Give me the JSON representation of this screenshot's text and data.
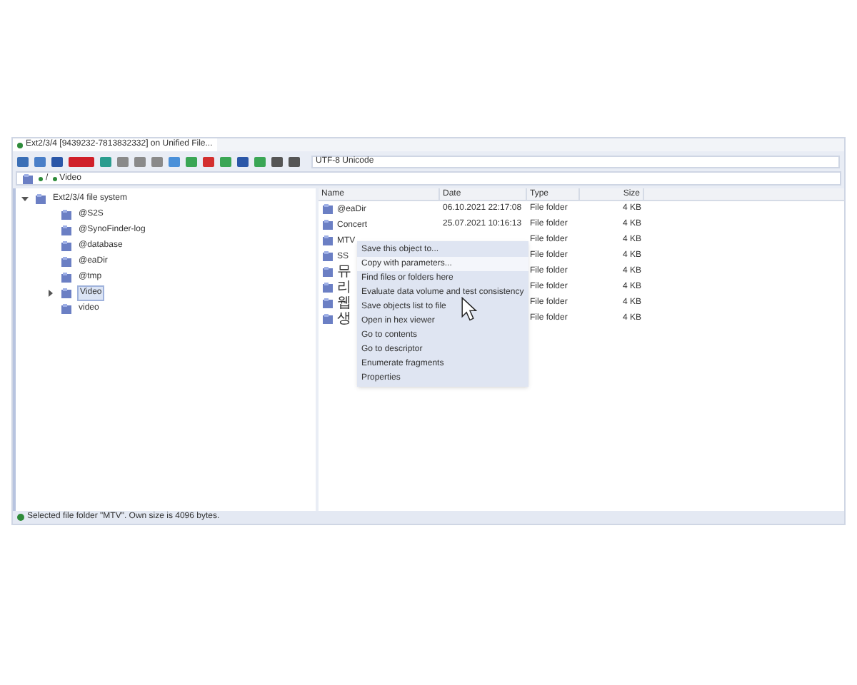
{
  "window": {
    "tab_title": "Ext2/3/4 [9439232-7813832332] on Unified File..."
  },
  "toolbar": {
    "encoding": "UTF-8 Unicode"
  },
  "path": [
    "/",
    "Video"
  ],
  "tree": {
    "label": "Ext2/3/4 file system",
    "expanded": true,
    "selected": false,
    "children": [
      {
        "label": "@S2S",
        "selected": false
      },
      {
        "label": "@SynoFinder-log",
        "selected": false
      },
      {
        "label": "@database",
        "selected": false
      },
      {
        "label": "@eaDir",
        "selected": false
      },
      {
        "label": "@tmp",
        "selected": false
      },
      {
        "label": "Video",
        "selected": true,
        "has_children": true
      },
      {
        "label": "video",
        "selected": false
      }
    ]
  },
  "table": {
    "columns": [
      "Name",
      "Date",
      "Type",
      "Size"
    ],
    "rows": [
      {
        "name": "@eaDir",
        "date": "06.10.2021 22:17:08",
        "type": "File folder",
        "size": "4 KB"
      },
      {
        "name": "Concert",
        "date": "25.07.2021 10:16:13",
        "type": "File folder",
        "size": "4 KB"
      },
      {
        "name": "MTV",
        "date": "",
        "type": "File folder",
        "size": "4 KB"
      },
      {
        "name": "SS",
        "date": "",
        "type": "File folder",
        "size": "4 KB"
      },
      {
        "name": "뮤",
        "date": "",
        "type": "File folder",
        "size": "4 KB"
      },
      {
        "name": "리",
        "date": "",
        "type": "File folder",
        "size": "4 KB"
      },
      {
        "name": "웹",
        "date": "",
        "type": "File folder",
        "size": "4 KB"
      },
      {
        "name": "생",
        "date": "",
        "type": "File folder",
        "size": "4 KB"
      }
    ]
  },
  "context_menu": [
    {
      "label": "Save this object to...",
      "selected": false
    },
    {
      "label": "Copy with parameters...",
      "selected": true
    },
    {
      "label": "Find files or folders here",
      "selected": false
    },
    {
      "label": "Evaluate data volume and test consistency",
      "selected": false
    },
    {
      "label": "Save objects list to file",
      "selected": false
    },
    {
      "label": "Open in hex viewer",
      "selected": false
    },
    {
      "label": "Go to contents",
      "selected": false
    },
    {
      "label": "Go to descriptor",
      "selected": false
    },
    {
      "label": "Enumerate fragments",
      "selected": false
    },
    {
      "label": "Properties",
      "selected": false
    }
  ],
  "status_bar": "Selected file folder \"MTV\". Own size is 4096 bytes."
}
